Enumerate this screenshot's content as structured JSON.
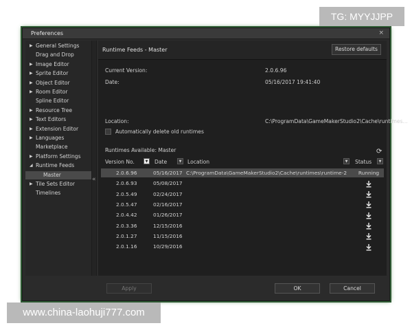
{
  "window": {
    "title": "Preferences",
    "close_glyph": "×"
  },
  "sidebar": {
    "collapse_glyph": "«",
    "items": [
      {
        "label": "General Settings",
        "arrow": "▶"
      },
      {
        "label": "Drag and Drop",
        "arrow": ""
      },
      {
        "label": "Image Editor",
        "arrow": "▶"
      },
      {
        "label": "Sprite Editor",
        "arrow": "▶"
      },
      {
        "label": "Object Editor",
        "arrow": "▶"
      },
      {
        "label": "Room Editor",
        "arrow": "▶"
      },
      {
        "label": "Spline Editor",
        "arrow": ""
      },
      {
        "label": "Resource Tree",
        "arrow": "▶"
      },
      {
        "label": "Text Editors",
        "arrow": "▶"
      },
      {
        "label": "Extension Editor",
        "arrow": "▶"
      },
      {
        "label": "Languages",
        "arrow": "▶"
      },
      {
        "label": "Marketplace",
        "arrow": ""
      },
      {
        "label": "Platform Settings",
        "arrow": "▶"
      },
      {
        "label": "Runtime Feeds",
        "arrow": "◢"
      },
      {
        "label": "Master",
        "arrow": ""
      },
      {
        "label": "Tile Sets Editor",
        "arrow": "▶"
      },
      {
        "label": "Timelines",
        "arrow": ""
      }
    ]
  },
  "panel": {
    "title": "Runtime Feeds - Master",
    "restore_label": "Restore defaults",
    "current_version_label": "Current Version:",
    "current_version_value": "2.0.6.96",
    "date_label": "Date:",
    "date_value": "05/16/2017 19:41:40",
    "location_label": "Location:",
    "location_value": "C:\\ProgramData\\GameMakerStudio2\\Cache\\runtimes...",
    "auto_delete_label": "Automatically delete old runtimes",
    "runtimes_available_label": "Runtimes Available:  Master",
    "refresh_glyph": "⟳"
  },
  "table": {
    "headers": {
      "version": "Version No.",
      "date": "Date",
      "location": "Location",
      "status": "Status"
    },
    "rows": [
      {
        "version": "2.0.6.96",
        "date": "05/16/2017",
        "location": "C:\\ProgramData\\GameMakerStudio2\\Cache\\runtimes\\runtime-2",
        "status": "Running"
      },
      {
        "version": "2.0.6.93",
        "date": "05/08/2017",
        "location": "",
        "status": ""
      },
      {
        "version": "2.0.5.49",
        "date": "02/24/2017",
        "location": "",
        "status": ""
      },
      {
        "version": "2.0.5.47",
        "date": "02/16/2017",
        "location": "",
        "status": ""
      },
      {
        "version": "2.0.4.42",
        "date": "01/26/2017",
        "location": "",
        "status": ""
      },
      {
        "version": "2.0.3.36",
        "date": "12/15/2016",
        "location": "",
        "status": ""
      },
      {
        "version": "2.0.1.27",
        "date": "11/15/2016",
        "location": "",
        "status": ""
      },
      {
        "version": "2.0.1.16",
        "date": "10/29/2016",
        "location": "",
        "status": ""
      }
    ]
  },
  "footer": {
    "apply_label": "Apply",
    "ok_label": "OK",
    "cancel_label": "Cancel"
  },
  "watermarks": {
    "top": "TG: MYYJJPP",
    "bottom": "www.china-laohuji777.com"
  },
  "colors": {
    "accent_glow": "#3f7a3f",
    "selection": "#4a4a4a",
    "background": "#2b2b2b"
  }
}
